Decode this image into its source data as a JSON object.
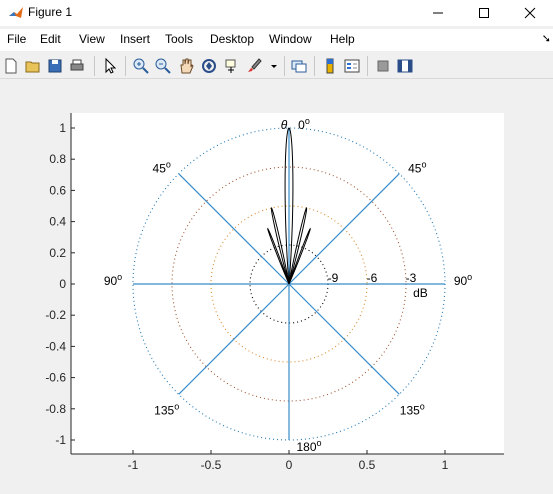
{
  "window": {
    "title": "Figure 1"
  },
  "menu": [
    "File",
    "Edit",
    "View",
    "Insert",
    "Tools",
    "Desktop",
    "Window",
    "Help"
  ],
  "toolbar_icons": [
    "new-figure-icon",
    "open-file-icon",
    "save-icon",
    "print-icon",
    "pointer-icon",
    "zoom-in-icon",
    "zoom-out-icon",
    "pan-icon",
    "rotate-3d-icon",
    "data-cursor-icon",
    "brush-icon",
    "link-plot-icon",
    "colorbar-icon",
    "legend-icon",
    "hide-plot-tools-icon",
    "show-plot-tools-icon"
  ],
  "chart_data": {
    "type": "line",
    "subtype": "polar-radiation-pattern",
    "title": "",
    "xlabel": "",
    "ylabel": "",
    "xlim": [
      -1.3,
      1.4
    ],
    "ylim": [
      -1.1,
      1.1
    ],
    "x_ticks": [
      "-1",
      "-0.5",
      "0",
      "0.5",
      "1"
    ],
    "y_ticks": [
      "1",
      "0.8",
      "0.6",
      "0.4",
      "0.2",
      "0",
      "-0.2",
      "-0.4",
      "-0.6",
      "-0.8",
      "-1"
    ],
    "grid": false,
    "angle_symbol": "θ",
    "angle_labels": [
      {
        "angle": 0,
        "text": "0",
        "sup": "o"
      },
      {
        "angle": 45,
        "text": "45",
        "sup": "o"
      },
      {
        "angle": -45,
        "text": "45",
        "sup": "o"
      },
      {
        "angle": 90,
        "text": "90",
        "sup": "o"
      },
      {
        "angle": -90,
        "text": "90",
        "sup": "o"
      },
      {
        "angle": 135,
        "text": "135",
        "sup": "o"
      },
      {
        "angle": -135,
        "text": "135",
        "sup": "o"
      },
      {
        "angle": 180,
        "text": "180",
        "sup": "o"
      }
    ],
    "db_rings": [
      {
        "label": "-9",
        "r": 0.25,
        "color": "#000000"
      },
      {
        "label": "-6",
        "r": 0.5,
        "color": "#d98b2b"
      },
      {
        "label": "-3",
        "r": 0.75,
        "color": "#a0522d"
      },
      {
        "label": "",
        "r": 1.0,
        "color": "#1f77b4"
      }
    ],
    "db_unit": "dB",
    "spoke_color": "#3a8cc8",
    "pattern_color": "#000000",
    "pattern_lobes": [
      {
        "center_deg": 0,
        "peak": 1.0,
        "width_deg": 5.5
      },
      {
        "center_deg": 13,
        "peak": 0.5,
        "width_deg": 3.2
      },
      {
        "center_deg": -13,
        "peak": 0.5,
        "width_deg": 3.2
      },
      {
        "center_deg": 21,
        "peak": 0.38,
        "width_deg": 2.6
      },
      {
        "center_deg": -21,
        "peak": 0.38,
        "width_deg": 2.6
      }
    ]
  }
}
